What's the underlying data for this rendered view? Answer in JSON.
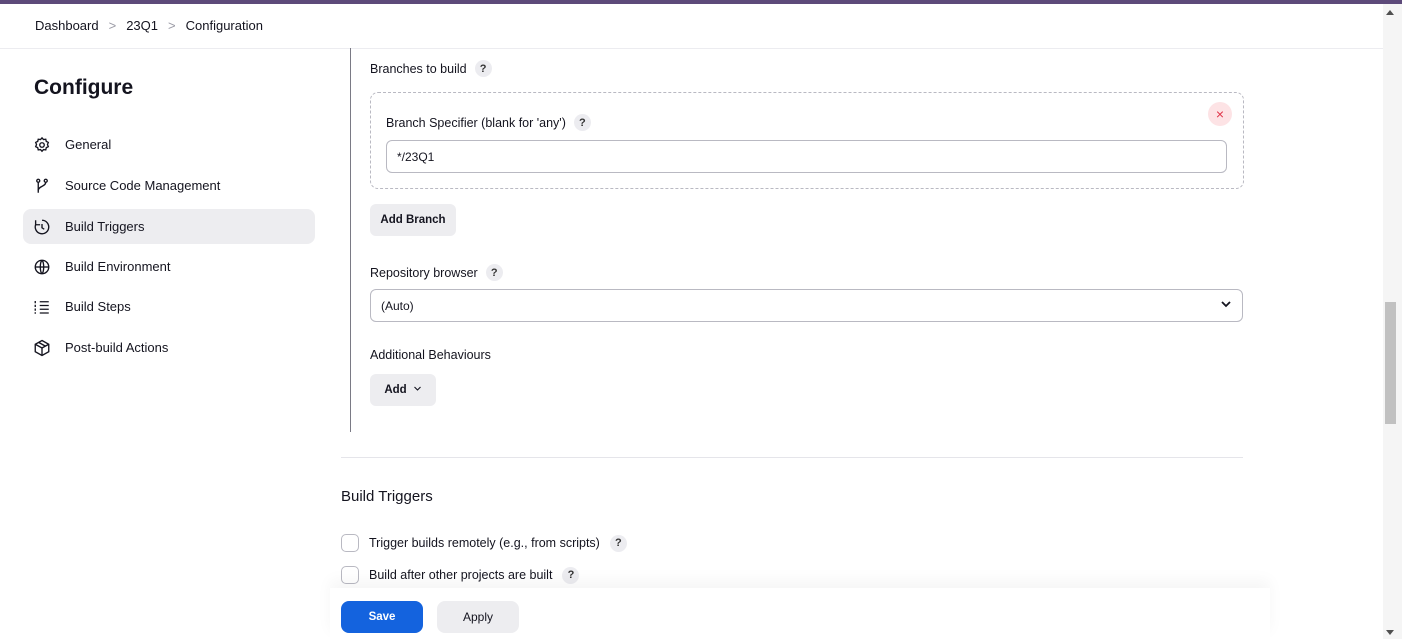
{
  "breadcrumb": {
    "items": [
      "Dashboard",
      "23Q1",
      "Configuration"
    ]
  },
  "sidebar": {
    "title": "Configure",
    "items": [
      {
        "label": "General",
        "icon": "gear-icon"
      },
      {
        "label": "Source Code Management",
        "icon": "branch-icon"
      },
      {
        "label": "Build Triggers",
        "icon": "timer-icon",
        "active": true
      },
      {
        "label": "Build Environment",
        "icon": "globe-icon"
      },
      {
        "label": "Build Steps",
        "icon": "list-icon"
      },
      {
        "label": "Post-build Actions",
        "icon": "package-icon"
      }
    ]
  },
  "scm": {
    "branches_label": "Branches to build",
    "branch_specifier_label": "Branch Specifier (blank for 'any')",
    "branch_specifier_value": "*/23Q1",
    "add_branch_label": "Add Branch",
    "repo_browser_label": "Repository browser",
    "repo_browser_value": "(Auto)",
    "additional_behaviours_label": "Additional Behaviours",
    "add_label": "Add"
  },
  "build_triggers": {
    "title": "Build Triggers",
    "options": [
      {
        "label": "Trigger builds remotely (e.g., from scripts)",
        "checked": false
      },
      {
        "label": "Build after other projects are built",
        "checked": false
      }
    ]
  },
  "footer": {
    "save_label": "Save",
    "apply_label": "Apply"
  },
  "help_symbol": "?",
  "close_symbol": "×",
  "colors": {
    "accent": "#1463de",
    "topbar": "#5d4a7a",
    "active_item_bg": "#ededf0",
    "danger": "#e0354a"
  }
}
